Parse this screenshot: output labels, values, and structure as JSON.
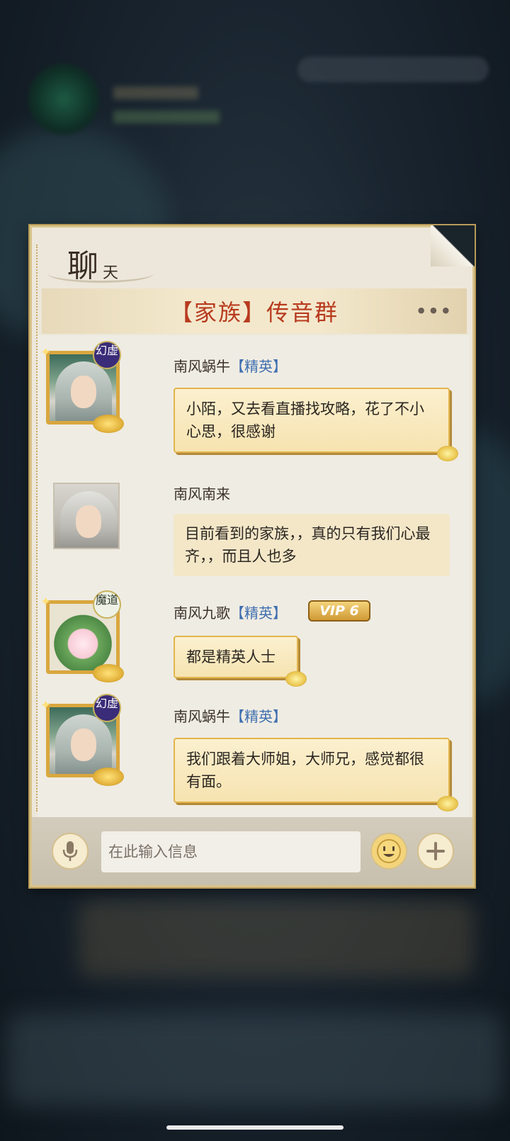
{
  "panel": {
    "title_big": "聊",
    "title_small": "天",
    "group_title": "【家族】传音群",
    "more_icon": "more-dots-icon",
    "more_label": "•••"
  },
  "messages": [
    {
      "sender": "南风蜗牛",
      "rank": "【精英】",
      "badge": "幻虚",
      "avatar": "male-white-hair",
      "text": "小陌，又去看直播找攻略，花了不小心思，很感谢"
    },
    {
      "sender": "南风南来",
      "rank": "",
      "badge": "",
      "avatar": "male-glasses",
      "text": "目前看到的家族，，真的只有我们心最齐，，而且人也多"
    },
    {
      "sender": "南风九歌",
      "rank": "【精英】",
      "badge": "魔道",
      "vip": "VIP 6",
      "avatar": "dumpling",
      "text": "都是精英人士"
    },
    {
      "sender": "南风蜗牛",
      "rank": "【精英】",
      "badge": "幻虚",
      "avatar": "male-white-hair",
      "text": "我们跟着大师姐，大师兄，感觉都很有面。"
    }
  ],
  "input": {
    "placeholder": "在此输入信息",
    "value": "",
    "mic_icon": "microphone-icon",
    "emoji_icon": "emoji-face-icon",
    "plus_icon": "plus-icon"
  },
  "colors": {
    "group_title": "#b83a1e",
    "rank": "#3f6fb0",
    "bubble_border": "#e2b54c"
  }
}
